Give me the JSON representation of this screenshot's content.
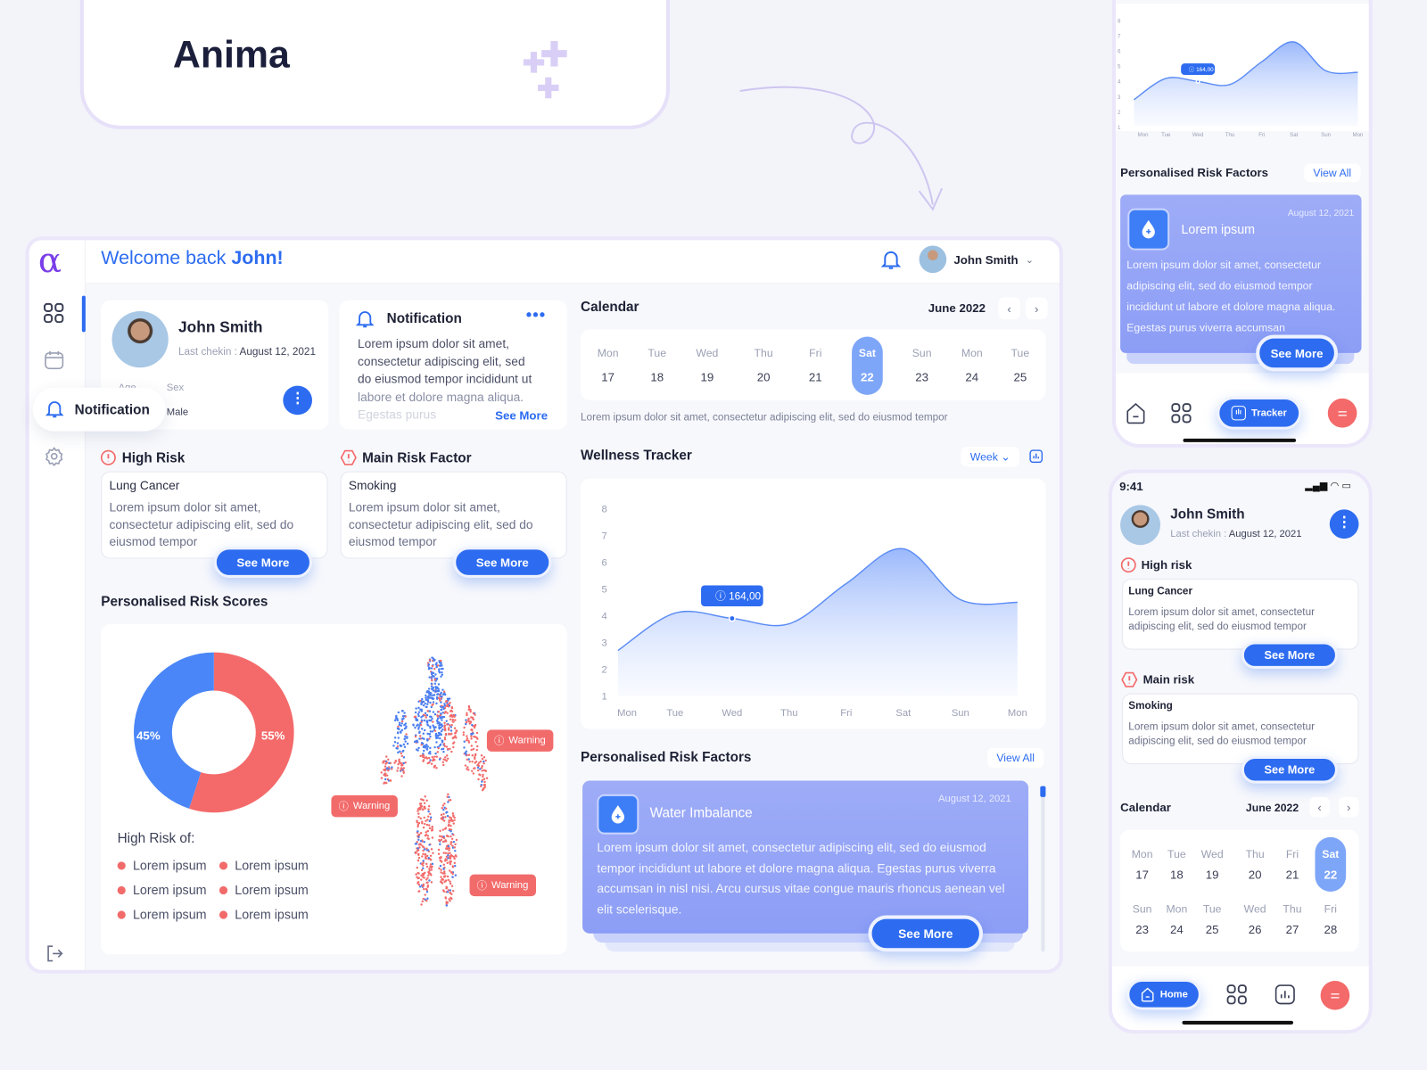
{
  "brand": {
    "name": "Anima"
  },
  "header": {
    "welcome": "Welcome back ",
    "name": "John!",
    "user": "John Smith"
  },
  "sidebar": {
    "tooltip": "Notification"
  },
  "profile": {
    "name": "John Smith",
    "checkin_label": "Last chekin : ",
    "checkin_date": "August 12, 2021",
    "age_label": "Age",
    "sex_label": "Sex",
    "sex": "Male"
  },
  "notification": {
    "title": "Notification",
    "lines": [
      "Lorem ipsum dolor sit amet,",
      "consectetur adipiscing elit, sed",
      "do eiusmod tempor incididunt ut",
      "labore et dolore magna aliqua.",
      "Egestas purus"
    ],
    "see_more": "See More"
  },
  "high_risk": {
    "title": "High Risk",
    "item": "Lung Cancer",
    "text": "Lorem ipsum dolor sit amet, consectetur adipiscing elit, sed do eiusmod tempor",
    "see_more": "See More"
  },
  "main_risk": {
    "title": "Main Risk Factor",
    "item": "Smoking",
    "text": "Lorem ipsum dolor sit amet, consectetur adipiscing elit, sed do eiusmod tempor",
    "see_more": "See More"
  },
  "risk_scores": {
    "title": "Personalised Risk Scores",
    "high_risk_of": "High Risk of:",
    "items": [
      "Lorem ipsum",
      "Lorem ipsum",
      "Lorem ipsum",
      "Lorem ipsum",
      "Lorem ipsum",
      "Lorem ipsum"
    ],
    "warning": "Warning",
    "colors": {
      "blue": "#4a86f7",
      "red": "#f46a6a"
    }
  },
  "calendar": {
    "title": "Calendar",
    "month": "June 2022",
    "days": [
      [
        "Mon",
        "17"
      ],
      [
        "Tue",
        "18"
      ],
      [
        "Wed",
        "19"
      ],
      [
        "Thu",
        "20"
      ],
      [
        "Fri",
        "21"
      ],
      [
        "Sat",
        "22"
      ],
      [
        "Sun",
        "23"
      ],
      [
        "Mon",
        "24"
      ],
      [
        "Tue",
        "25"
      ]
    ],
    "selected": "22",
    "caption": "Lorem ipsum dolor sit amet, consectetur adipiscing elit, sed do eiusmod tempor"
  },
  "tracker": {
    "title": "Wellness Tracker",
    "range": "Week",
    "tooltip": "164,00"
  },
  "risk_factors": {
    "title": "Personalised Risk Factors",
    "view_all": "View All",
    "card": {
      "title": "Water Imbalance",
      "date": "August 12, 2021",
      "text": "Lorem ipsum dolor sit amet, consectetur adipiscing elit, sed do eiusmod tempor incididunt ut labore et dolore magna aliqua. Egestas purus viverra accumsan in nisl nisi. Arcu cursus vitae congue mauris rhoncus aenean vel elit scelerisque.",
      "see_more": "See More"
    }
  },
  "mobile1": {
    "title": "Personalised Risk Factors",
    "view_all": "View All",
    "card": {
      "title": "Lorem ipsum",
      "date": "August 12, 2021",
      "text": "Lorem ipsum dolor sit amet, consectetur adipiscing elit, sed do eiusmod tempor incididunt ut labore et dolore magna aliqua. Egestas purus viverra accumsan",
      "see_more": "See More"
    },
    "nav": {
      "tracker": "Tracker"
    },
    "tooltip": "164,00"
  },
  "mobile2": {
    "time": "9:41",
    "name": "John Smith",
    "checkin_label": "Last chekin : ",
    "checkin_date": "August 12, 2021",
    "high_risk": "High risk",
    "high_item": "Lung Cancer",
    "main_risk": "Main risk",
    "main_item": "Smoking",
    "text": "Lorem ipsum dolor sit amet, consectetur adipiscing elit, sed do eiusmod tempor",
    "see_more": "See More",
    "calendar": "Calendar",
    "month": "June 2022",
    "days": [
      [
        "Mon",
        "17"
      ],
      [
        "Tue",
        "18"
      ],
      [
        "Wed",
        "19"
      ],
      [
        "Thu",
        "20"
      ],
      [
        "Fri",
        "21"
      ],
      [
        "Sat",
        "22"
      ],
      [
        "Sun",
        "23"
      ],
      [
        "Mon",
        "24"
      ],
      [
        "Tue",
        "25"
      ],
      [
        "Wed",
        "26"
      ],
      [
        "Thu",
        "27"
      ],
      [
        "Fri",
        "28"
      ]
    ],
    "nav": {
      "home": "Home"
    }
  },
  "colors": {
    "primary": "#2d6cf0",
    "accent_red": "#f46a6a",
    "card_lavender": "#95a6f6"
  },
  "chart_data": {
    "type": "area",
    "categories": [
      "Mon",
      "Tue",
      "Wed",
      "Thu",
      "Fri",
      "Sat",
      "Sun",
      "Mon"
    ],
    "values": [
      2.7,
      4.1,
      3.9,
      3.7,
      5.2,
      6.5,
      4.6,
      4.5
    ],
    "highlight": {
      "category": "Wed",
      "label": "164,00"
    },
    "ylim": [
      1,
      8
    ],
    "yticks": [
      1,
      2,
      3,
      4,
      5,
      6,
      7,
      8
    ],
    "grid": false
  },
  "donut": {
    "values": [
      45,
      55
    ],
    "labels": [
      "45%",
      "55%"
    ]
  }
}
